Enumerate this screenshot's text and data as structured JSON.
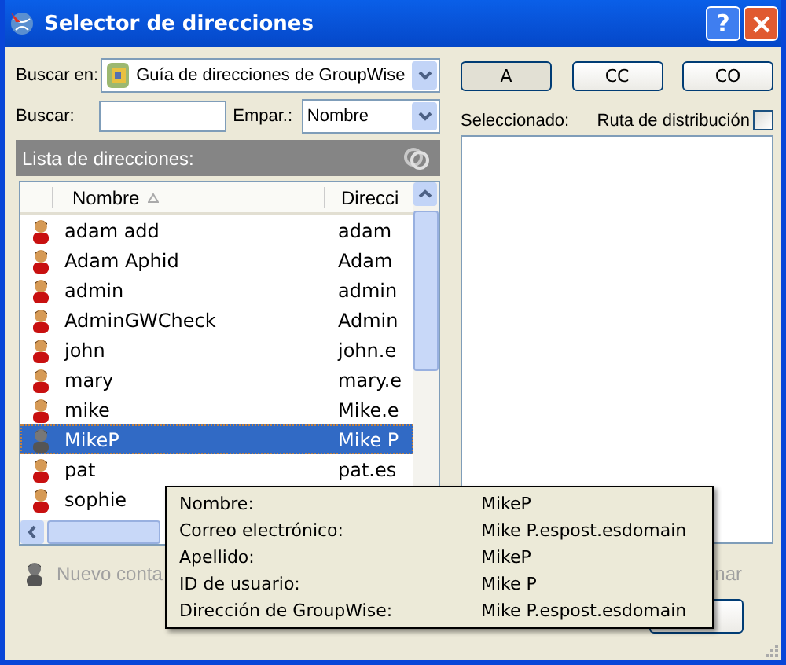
{
  "window": {
    "title": "Selector de direcciones",
    "help": "?"
  },
  "search_in": {
    "label": "Buscar en:",
    "value": "Guía de direcciones de GroupWise"
  },
  "search": {
    "label": "Buscar:"
  },
  "match": {
    "label": "Empar.:",
    "value": "Nombre"
  },
  "list": {
    "title": "Lista de direcciones:",
    "columns": [
      {
        "label": "Nombre",
        "sorted": true
      },
      {
        "label": "Direcci",
        "sorted": false
      }
    ],
    "rows": [
      {
        "name": "adam add",
        "address": "adam",
        "selected": false
      },
      {
        "name": "Adam Aphid",
        "address": "Adam",
        "selected": false
      },
      {
        "name": "admin",
        "address": "admin",
        "selected": false
      },
      {
        "name": "AdminGWCheck",
        "address": "Admin",
        "selected": false
      },
      {
        "name": "john",
        "address": "john.e",
        "selected": false
      },
      {
        "name": "mary",
        "address": "mary.e",
        "selected": false
      },
      {
        "name": "mike",
        "address": "Mike.e",
        "selected": false
      },
      {
        "name": "MikeP",
        "address": "Mike P",
        "selected": true
      },
      {
        "name": "pat",
        "address": "pat.es",
        "selected": false
      },
      {
        "name": "sophie",
        "selected": false
      }
    ]
  },
  "recipient_buttons": [
    {
      "label": "A",
      "selected": true
    },
    {
      "label": "CC",
      "selected": false
    },
    {
      "label": "CO",
      "selected": false
    }
  ],
  "selected_label": "Seleccionado:",
  "distribution": {
    "label": "Ruta de distribución",
    "checked": false
  },
  "footer": {
    "new_contact": "Nuevo conta",
    "right_text": "nar"
  },
  "tooltip": {
    "rows": [
      {
        "label": "Nombre:",
        "value": "MikeP"
      },
      {
        "label": "Correo electrónico:",
        "value": "Mike P.espost.esdomain"
      },
      {
        "label": "Apellido:",
        "value": "MikeP"
      },
      {
        "label": "ID de usuario:",
        "value": "Mike P"
      },
      {
        "label": "Dirección de GroupWise:",
        "value": "Mike P.espost.esdomain"
      }
    ]
  }
}
